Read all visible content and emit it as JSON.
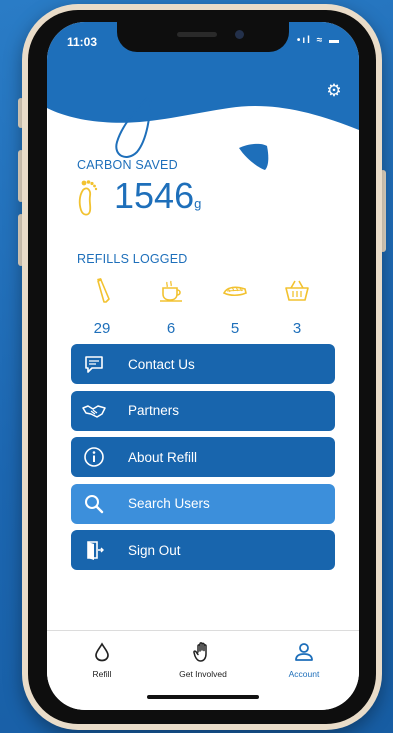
{
  "status_bar": {
    "time": "11:03",
    "icons": "•ıl ≈ ▬"
  },
  "header": {
    "settings_icon": "gear-icon",
    "brand_color": "#1e6fba"
  },
  "carbon": {
    "label": "CARBON SAVED",
    "value": "1546",
    "unit": "g"
  },
  "refills": {
    "label": "REFILLS LOGGED",
    "items": [
      {
        "icon": "bottle-icon",
        "count": "29"
      },
      {
        "icon": "coffee-cup-icon",
        "count": "6"
      },
      {
        "icon": "lunchbox-icon",
        "count": "5"
      },
      {
        "icon": "shopping-basket-icon",
        "count": "3"
      }
    ]
  },
  "menu": {
    "items": [
      {
        "label": "Contact Us",
        "icon": "chat-bubble-icon"
      },
      {
        "label": "Partners",
        "icon": "handshake-icon"
      },
      {
        "label": "About Refill",
        "icon": "info-icon"
      },
      {
        "label": "Search Users",
        "icon": "search-icon"
      },
      {
        "label": "Sign Out",
        "icon": "door-exit-icon"
      }
    ]
  },
  "tabbar": {
    "items": [
      {
        "label": "Refill",
        "icon": "water-drop-icon"
      },
      {
        "label": "Get Involved",
        "icon": "hand-icon"
      },
      {
        "label": "Account",
        "icon": "person-icon"
      }
    ],
    "selected": "Account"
  },
  "colors": {
    "accent": "#1e6fba",
    "menu_bg": "#1865ad",
    "menu_active": "#3c8fdb",
    "icon_yellow": "#f2c230"
  }
}
